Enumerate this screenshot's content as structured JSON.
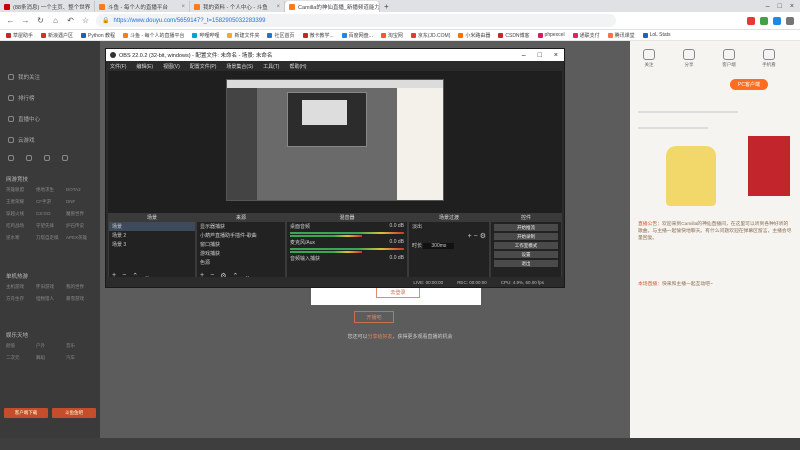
{
  "browser": {
    "tabs": [
      {
        "label": "(88条消息) 一个主页、整个世界",
        "color": "#c00"
      },
      {
        "label": "斗鱼 - 每个人的直播平台",
        "color": "#ff7a1a"
      },
      {
        "label": "我的资料 - 个人中心 - 斗鱼",
        "color": "#ff7a1a"
      },
      {
        "label": "Camilla的神仙直播_新播频道能力...",
        "color": "#ff7a1a",
        "active": true
      }
    ],
    "url": "https://www.douyu.com/5659147?_t=1582905032283399",
    "bookmarks": [
      "草屋助手",
      "新浪遇户区",
      "Python 教程",
      "斗鱼 - 每个人的直播平台",
      "哔哩哔哩",
      "新建文件夹",
      "社区首页",
      "微卡教学...",
      "百度网盘...",
      "淘宝网",
      "京东(JD.COM)",
      "小米路由器",
      "CSDN博客",
      "phpexcel",
      "通联支付",
      "腾讯课堂",
      "LoL Stats"
    ]
  },
  "leftnav": {
    "items": [
      "我的关注",
      "排行榜",
      "直播中心",
      "云游戏"
    ],
    "section1": "网游竞技",
    "section1_items": [
      "英雄联盟",
      "绝地求生",
      "DOTA2",
      "王者荣耀",
      "CF手游",
      "DNF",
      "穿越火线",
      "CS:GO",
      "魔兽世界",
      "吃鸡战场",
      "守望先锋",
      "炉石传说",
      "逆水寒",
      "刀塔自走棋",
      "APEX英雄"
    ],
    "section2": "单机热游",
    "section2_items": [
      "主机游戏",
      "怀旧游戏",
      "我的世界",
      "方舟生存",
      "怪物猎人",
      "暴雪游戏"
    ],
    "section3": "娱乐天地",
    "section3_items": [
      "颜值",
      "户外",
      "音乐",
      "二次元",
      "舞蹈",
      "汽车"
    ],
    "bottom_buttons": [
      "客户端下载",
      "斗鱼鱼吧"
    ]
  },
  "obs": {
    "title": "OBS 22.0.2 (32-bit, windows) - 配置文件: 未命名 - 场景: 未命名",
    "menu": [
      "文件(F)",
      "编辑(E)",
      "视图(V)",
      "配置文件(P)",
      "场景集合(S)",
      "工具(T)",
      "帮助(H)"
    ],
    "scenes_header": "场景",
    "scenes": [
      "场景",
      "场景 2",
      "场景 3"
    ],
    "sources_header": "来源",
    "sources": [
      "显示器捕获",
      "小葫芦直播助手插件-歌曲",
      "窗口捕获",
      "游戏捕获",
      "色源"
    ],
    "mixer_header": "混音器",
    "mixer": [
      {
        "name": "桌面音频",
        "value": "0.0 dB"
      },
      {
        "name": "麦克风/Aux",
        "value": "0.0 dB"
      },
      {
        "name": "音频输入捕获",
        "value": "0.0 dB"
      }
    ],
    "transition_header": "场景过渡",
    "transition_name": "淡出",
    "transition_label": "时长",
    "transition_duration": "300ms",
    "controls_header": "控件",
    "controls": [
      "开始推流",
      "开始录制",
      "工作室模式",
      "设置",
      "退出"
    ],
    "status": [
      "LIVE: 00:00:00",
      "REC: 00:00:00",
      "CPU: 4.9%, 60.00 fps"
    ]
  },
  "overlay": {
    "card_button": "去登录",
    "big_button": "开播吧",
    "hint_pre": "您还可以",
    "hint_link": "分享给好友",
    "hint_post": "，获得更多观看直播的机会"
  },
  "rightpanel": {
    "icons": [
      "关注",
      "分享",
      "客户端",
      "手机看",
      "更多"
    ],
    "orange_button": "PC客户端",
    "notice_title": "直播公告：",
    "notice": "欢迎来到Camilla的神仙直播间，在这里可以听到各种好听的歌曲，与主播一起愉快地聊天。有什么问题欢迎在弹幕区留言，主播会尽量回复。",
    "notice2_title": "本场直播：",
    "notice2": "快来和主播一起互动吧~"
  }
}
